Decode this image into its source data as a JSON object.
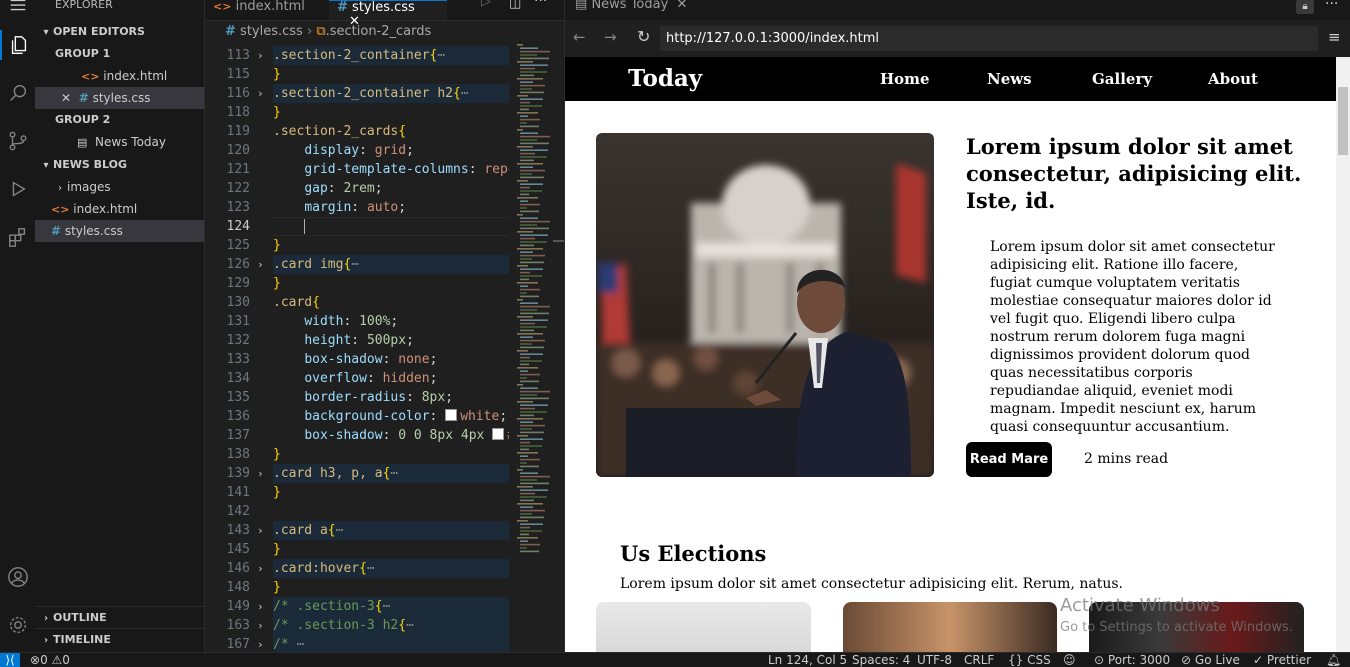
{
  "activity_bar": {
    "icons": [
      "menu-icon",
      "explorer-icon",
      "search-icon",
      "source-control-icon",
      "run-debug-icon",
      "extensions-icon",
      "account-icon",
      "settings-gear-icon"
    ]
  },
  "sidebar": {
    "title": "EXPLORER",
    "open_editors": {
      "label": "OPEN EDITORS",
      "group1": {
        "label": "GROUP 1",
        "items": [
          {
            "name": "index.html"
          },
          {
            "name": "styles.css"
          }
        ]
      },
      "group2": {
        "label": "GROUP 2",
        "items": [
          {
            "name": "News Today"
          }
        ]
      }
    },
    "project": {
      "label": "NEWS BLOG",
      "items": [
        {
          "name": "images"
        },
        {
          "name": "index.html"
        },
        {
          "name": "styles.css"
        }
      ]
    },
    "outline": "OUTLINE",
    "timeline": "TIMELINE"
  },
  "editor": {
    "tabs": [
      {
        "label": "index.html"
      },
      {
        "label": "styles.css"
      }
    ],
    "breadcrumb": {
      "file": "styles.css",
      "symbol": ".section-2_cards"
    },
    "lines": [
      {
        "n": "113",
        "fold": true,
        "t": [
          [
            "sel",
            ".section-2_container"
          ],
          [
            "br",
            "{"
          ],
          [
            "dots",
            "⋯"
          ]
        ]
      },
      {
        "n": "115",
        "t": [
          [
            "br",
            "}"
          ]
        ]
      },
      {
        "n": "116",
        "fold": true,
        "t": [
          [
            "sel",
            ".section-2_container h2"
          ],
          [
            "br",
            "{"
          ],
          [
            "dots",
            "⋯"
          ]
        ]
      },
      {
        "n": "118",
        "t": [
          [
            "br",
            "}"
          ]
        ]
      },
      {
        "n": "119",
        "t": [
          [
            "sel",
            ".section-2_cards"
          ],
          [
            "br",
            "{"
          ]
        ]
      },
      {
        "n": "120",
        "t": [
          [
            "punc",
            "    "
          ],
          [
            "prop",
            "display"
          ],
          [
            "punc",
            ": "
          ],
          [
            "val",
            "grid"
          ],
          [
            "punc",
            ";"
          ]
        ]
      },
      {
        "n": "121",
        "t": [
          [
            "punc",
            "    "
          ],
          [
            "prop",
            "grid-template-columns"
          ],
          [
            "punc",
            ": "
          ],
          [
            "val",
            "repe"
          ]
        ]
      },
      {
        "n": "122",
        "t": [
          [
            "punc",
            "    "
          ],
          [
            "prop",
            "gap"
          ],
          [
            "punc",
            ": "
          ],
          [
            "num",
            "2rem"
          ],
          [
            "punc",
            ";"
          ]
        ]
      },
      {
        "n": "123",
        "t": [
          [
            "punc",
            "    "
          ],
          [
            "prop",
            "margin"
          ],
          [
            "punc",
            ": "
          ],
          [
            "val",
            "auto"
          ],
          [
            "punc",
            ";"
          ]
        ]
      },
      {
        "n": "124",
        "cur": true,
        "t": [
          [
            "punc",
            "    "
          ]
        ]
      },
      {
        "n": "125",
        "t": [
          [
            "br",
            "}"
          ]
        ]
      },
      {
        "n": "126",
        "fold": true,
        "t": [
          [
            "sel",
            ".card img"
          ],
          [
            "br",
            "{"
          ],
          [
            "dots",
            "⋯"
          ]
        ]
      },
      {
        "n": "129",
        "t": [
          [
            "br",
            "}"
          ]
        ]
      },
      {
        "n": "130",
        "t": [
          [
            "sel",
            ".card"
          ],
          [
            "br",
            "{"
          ]
        ]
      },
      {
        "n": "131",
        "t": [
          [
            "punc",
            "    "
          ],
          [
            "prop",
            "width"
          ],
          [
            "punc",
            ": "
          ],
          [
            "num",
            "100%"
          ],
          [
            "punc",
            ";"
          ]
        ]
      },
      {
        "n": "132",
        "t": [
          [
            "punc",
            "    "
          ],
          [
            "prop",
            "height"
          ],
          [
            "punc",
            ": "
          ],
          [
            "num",
            "500px"
          ],
          [
            "punc",
            ";"
          ]
        ]
      },
      {
        "n": "133",
        "t": [
          [
            "punc",
            "    "
          ],
          [
            "prop",
            "box-shadow"
          ],
          [
            "punc",
            ": "
          ],
          [
            "val",
            "none"
          ],
          [
            "punc",
            ";"
          ]
        ]
      },
      {
        "n": "134",
        "t": [
          [
            "punc",
            "    "
          ],
          [
            "prop",
            "overflow"
          ],
          [
            "punc",
            ": "
          ],
          [
            "val",
            "hidden"
          ],
          [
            "punc",
            ";"
          ]
        ]
      },
      {
        "n": "135",
        "t": [
          [
            "punc",
            "    "
          ],
          [
            "prop",
            "border-radius"
          ],
          [
            "punc",
            ": "
          ],
          [
            "num",
            "8px"
          ],
          [
            "punc",
            ";"
          ]
        ]
      },
      {
        "n": "136",
        "t": [
          [
            "punc",
            "    "
          ],
          [
            "prop",
            "background-color"
          ],
          [
            "punc",
            ": "
          ],
          [
            "swatch",
            ""
          ],
          [
            "val",
            "white"
          ],
          [
            "punc",
            ";"
          ]
        ]
      },
      {
        "n": "137",
        "t": [
          [
            "punc",
            "    "
          ],
          [
            "prop",
            "box-shadow"
          ],
          [
            "punc",
            ": "
          ],
          [
            "num",
            "0 0 8px 4px "
          ],
          [
            "swatch",
            ""
          ],
          [
            "val",
            "#"
          ]
        ]
      },
      {
        "n": "138",
        "t": [
          [
            "br",
            "}"
          ]
        ]
      },
      {
        "n": "139",
        "fold": true,
        "t": [
          [
            "sel",
            ".card h3, p, a"
          ],
          [
            "br",
            "{"
          ],
          [
            "dots",
            "⋯"
          ]
        ]
      },
      {
        "n": "141",
        "t": [
          [
            "br",
            "}"
          ]
        ]
      },
      {
        "n": "142",
        "t": []
      },
      {
        "n": "143",
        "fold": true,
        "t": [
          [
            "sel",
            ".card a"
          ],
          [
            "br",
            "{"
          ],
          [
            "dots",
            "⋯"
          ]
        ]
      },
      {
        "n": "145",
        "t": [
          [
            "br",
            "}"
          ]
        ]
      },
      {
        "n": "146",
        "fold": true,
        "t": [
          [
            "sel",
            ".card:hover"
          ],
          [
            "br",
            "{"
          ],
          [
            "dots",
            "⋯"
          ]
        ]
      },
      {
        "n": "148",
        "t": [
          [
            "br",
            "}"
          ]
        ]
      },
      {
        "n": "149",
        "fold": true,
        "t": [
          [
            "cmt",
            "/* .section-3"
          ],
          [
            "br",
            "{"
          ],
          [
            "dots",
            "⋯"
          ]
        ]
      },
      {
        "n": "163",
        "fold": true,
        "t": [
          [
            "cmt",
            "/* .section-3 h2"
          ],
          [
            "br",
            "{"
          ],
          [
            "dots",
            "⋯"
          ]
        ]
      },
      {
        "n": "167",
        "fold": true,
        "t": [
          [
            "cmt",
            "/* "
          ],
          [
            "dots",
            "⋯"
          ]
        ]
      }
    ]
  },
  "browser": {
    "tab_title": "News Today",
    "url": "http://127.0.0.1:3000/index.html",
    "site": {
      "brand": "Today",
      "nav": [
        "Home",
        "News",
        "Gallery",
        "About"
      ],
      "hero": {
        "title": "Lorem ipsum dolor sit amet consectetur, adipisicing elit. Iste, id.",
        "body": "Lorem ipsum dolor sit amet consectetur adipisicing elit. Ratione illo facere, fugiat cumque voluptatem veritatis molestiae consequatur maiores dolor id vel fugit quo. Eligendi libero culpa nostrum rerum dolorem fuga magni dignissimos provident dolorum quod quas necessitatibus corporis repudiandae aliquid, eveniet modi magnam. Impedit nesciunt ex, harum quasi consequuntur accusantium.",
        "button": "Read Mare",
        "read_time": "2 mins read"
      },
      "section": {
        "title": "Us Elections",
        "subtitle": "Lorem ipsum dolor sit amet consectetur adipisicing elit. Rerum, natus."
      }
    },
    "watermark": {
      "line1": "Activate Windows",
      "line2": "Go to Settings to activate Windows."
    }
  },
  "status_bar": {
    "errors": "0",
    "warnings": "0",
    "position": "Ln 124, Col 5",
    "spaces": "Spaces: 4",
    "encoding": "UTF-8",
    "eol": "CRLF",
    "language": "CSS",
    "port": "Port: 3000",
    "golive": "Go Live",
    "prettier": "Prettier"
  },
  "colors": {
    "accent": "#0078d4",
    "nav_bg": "#000000",
    "selector": "#d7ba7d",
    "property": "#9cdcfe"
  }
}
